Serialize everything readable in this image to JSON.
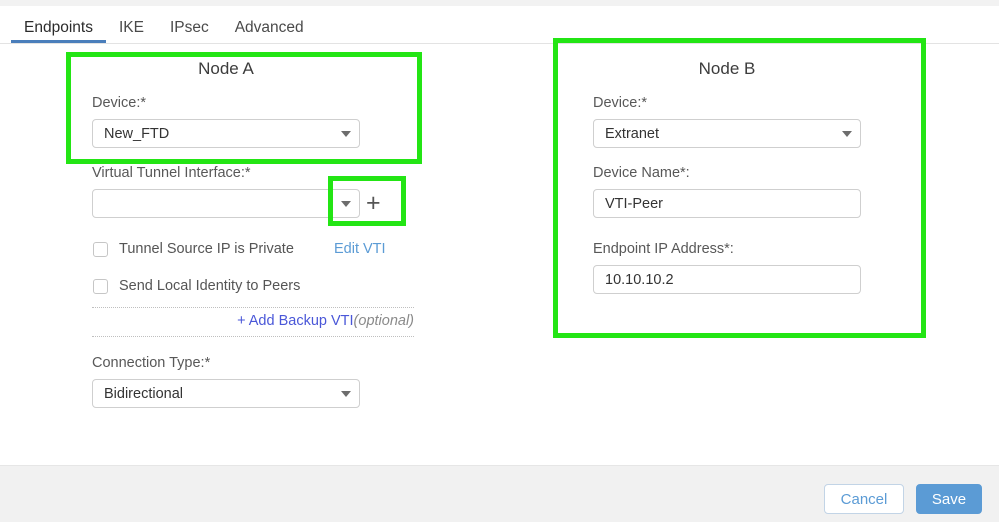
{
  "tabs": [
    {
      "label": "Endpoints",
      "active": true
    },
    {
      "label": "IKE",
      "active": false
    },
    {
      "label": "IPsec",
      "active": false
    },
    {
      "label": "Advanced",
      "active": false
    }
  ],
  "node_a": {
    "title": "Node A",
    "device_label": "Device:*",
    "device_value": "New_FTD",
    "vti_label": "Virtual Tunnel Interface:*",
    "vti_value": "",
    "add_vti_icon": "+",
    "checkbox_tunnel_source": {
      "label": "Tunnel Source IP is Private",
      "checked": false
    },
    "edit_vti_link": "Edit VTI",
    "checkbox_send_identity": {
      "label": "Send Local Identity to Peers",
      "checked": false
    },
    "add_backup_vti_link": "+ Add Backup VTI",
    "add_backup_vti_optional": "(optional)",
    "connection_type_label": "Connection Type:*",
    "connection_type_value": "Bidirectional"
  },
  "node_b": {
    "title": "Node B",
    "device_label": "Device:*",
    "device_value": "Extranet",
    "device_name_label": "Device Name*:",
    "device_name_value": "VTI-Peer",
    "endpoint_ip_label": "Endpoint IP Address*:",
    "endpoint_ip_value": "10.10.10.2"
  },
  "footer": {
    "cancel_label": "Cancel",
    "save_label": "Save"
  },
  "colors": {
    "annotation_green": "#23e514",
    "accent_blue": "#5b9bd5",
    "tab_underline": "#4a7ebb",
    "backup_link": "#4a57d8"
  }
}
